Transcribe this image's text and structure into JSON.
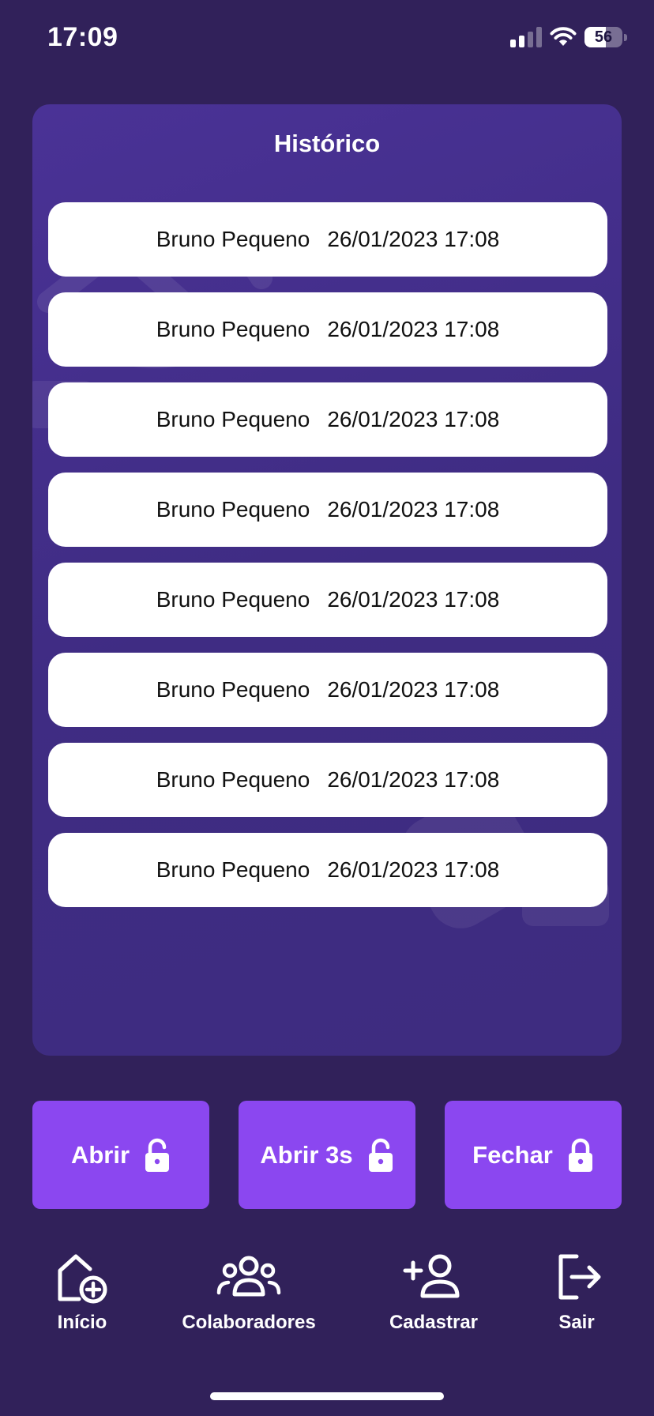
{
  "status_bar": {
    "time": "17:09",
    "battery_level": "56"
  },
  "history": {
    "title": "Histórico",
    "entries": [
      {
        "name": "Bruno Pequeno",
        "datetime": "26/01/2023 17:08"
      },
      {
        "name": "Bruno Pequeno",
        "datetime": "26/01/2023 17:08"
      },
      {
        "name": "Bruno Pequeno",
        "datetime": "26/01/2023 17:08"
      },
      {
        "name": "Bruno Pequeno",
        "datetime": "26/01/2023 17:08"
      },
      {
        "name": "Bruno Pequeno",
        "datetime": "26/01/2023 17:08"
      },
      {
        "name": "Bruno Pequeno",
        "datetime": "26/01/2023 17:08"
      },
      {
        "name": "Bruno Pequeno",
        "datetime": "26/01/2023 17:08"
      },
      {
        "name": "Bruno Pequeno",
        "datetime": "26/01/2023 17:08"
      }
    ]
  },
  "actions": {
    "open_label": "Abrir",
    "open_3s_label": "Abrir 3s",
    "close_label": "Fechar",
    "open_icon": "unlock-icon",
    "close_icon": "lock-icon"
  },
  "nav": {
    "items": [
      {
        "label": "Início",
        "icon": "home-add-icon"
      },
      {
        "label": "Colaboradores",
        "icon": "users-group-icon"
      },
      {
        "label": "Cadastrar",
        "icon": "add-user-icon"
      },
      {
        "label": "Sair",
        "icon": "logout-icon"
      }
    ]
  },
  "colors": {
    "background": "#31215a",
    "card": "#43308a",
    "accent": "#8b47f0",
    "row": "#ffffff"
  }
}
